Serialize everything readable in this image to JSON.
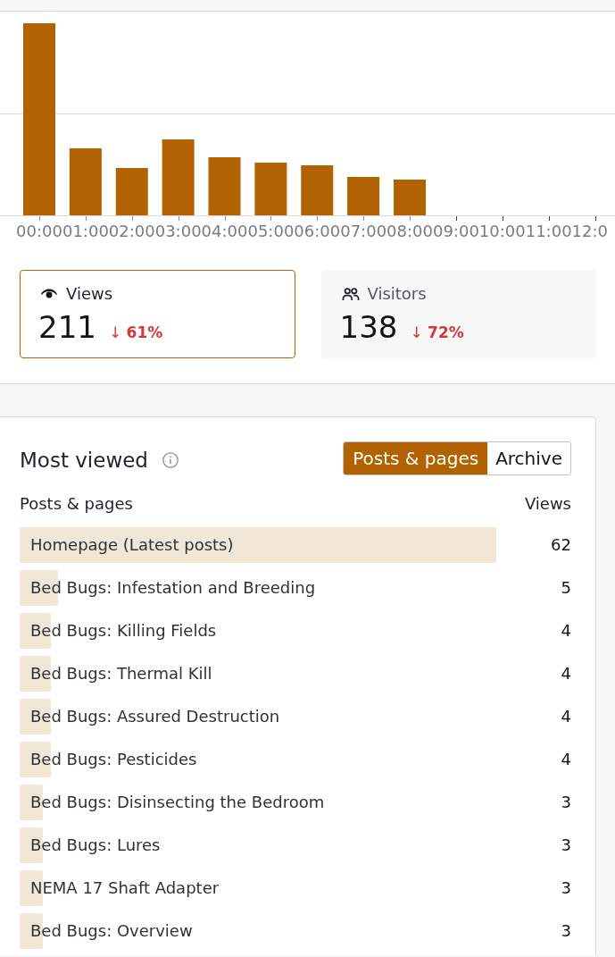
{
  "chart": {
    "x_labels": [
      "00:00",
      "01:00",
      "02:00",
      "03:00",
      "04:00",
      "05:00",
      "06:00",
      "07:00",
      "08:00",
      "09:00",
      "10:00",
      "11:00",
      "12:0"
    ]
  },
  "stats": [
    {
      "kind": "views",
      "label": "Views",
      "value": "211",
      "change": "↓ **61%**",
      "selected": true
    },
    {
      "kind": "visitors",
      "label": "Visitors",
      "value": "138",
      "change": "↓ **72%**",
      "selected": false
    }
  ],
  "most_viewed": {
    "title": "Most viewed",
    "tabs": [
      {
        "label": "Posts & pages",
        "selected": true
      },
      {
        "label": "Archive",
        "selected": false
      }
    ],
    "columns": [
      "Posts & pages",
      "Views"
    ],
    "rows": [
      {
        "title": "Homepage (Latest posts)",
        "views": "62",
        "level": 0.864
      },
      {
        "title": "Bed Bugs: Infestation and Breeding",
        "views": "5",
        "level": 0.07
      },
      {
        "title": "Bed Bugs: Killing Fields",
        "views": "4",
        "level": 0.056
      },
      {
        "title": "Bed Bugs: Thermal Kill",
        "views": "4",
        "level": 0.056
      },
      {
        "title": "Bed Bugs: Assured Destruction",
        "views": "4",
        "level": 0.056
      },
      {
        "title": "Bed Bugs: Pesticides",
        "views": "4",
        "level": 0.056
      },
      {
        "title": "Bed Bugs: Disinsecting the Bedroom",
        "views": "3",
        "level": 0.042
      },
      {
        "title": "Bed Bugs: Lures",
        "views": "3",
        "level": 0.042
      },
      {
        "title": "NEMA 17 Shaft Adapter",
        "views": "3",
        "level": 0.042
      },
      {
        "title": "Bed Bugs: Overview",
        "views": "3",
        "level": 0.042
      }
    ]
  }
}
